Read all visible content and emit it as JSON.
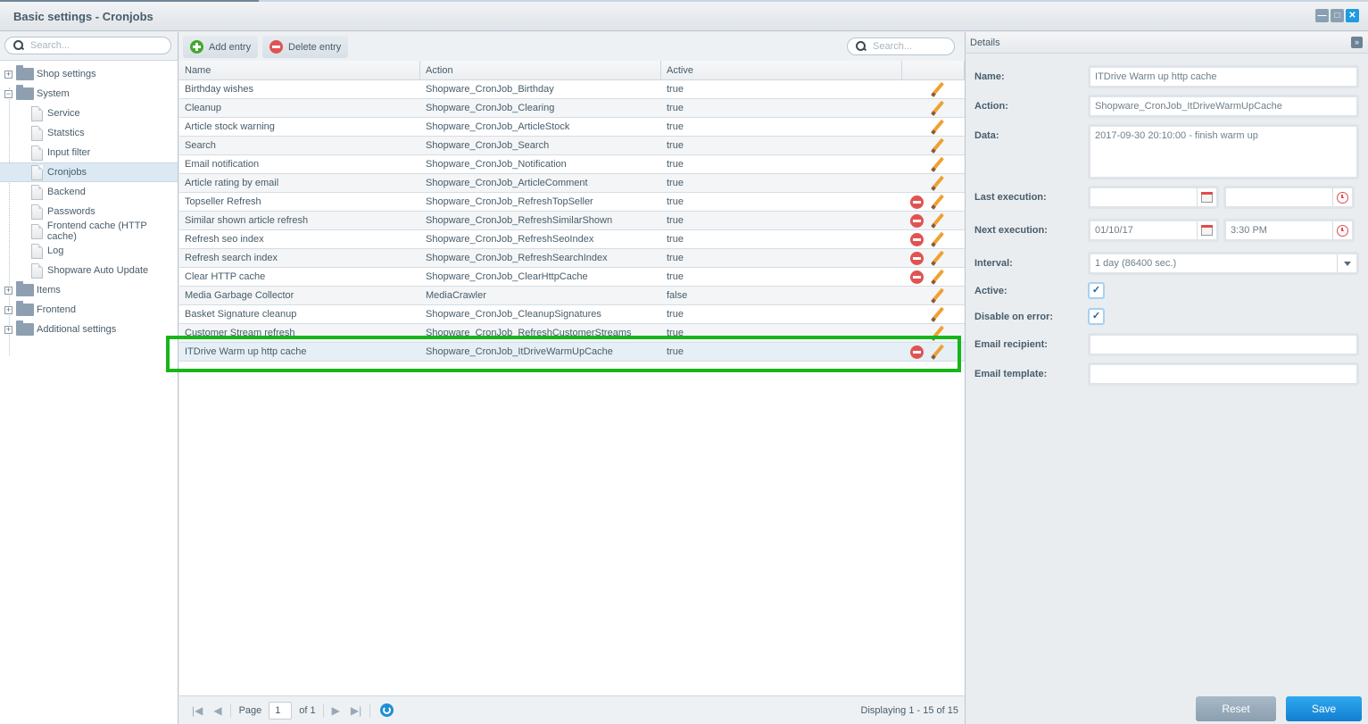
{
  "window": {
    "title": "Basic settings - Cronjobs",
    "buttons": {
      "minimize": "minimize-icon",
      "maximize": "maximize-icon",
      "close": "close-icon"
    }
  },
  "tree": {
    "search_placeholder": "Search...",
    "nodes": [
      {
        "label": "Shop settings",
        "type": "folder",
        "expanded": false
      },
      {
        "label": "System",
        "type": "folder",
        "expanded": true
      },
      {
        "label": "Service",
        "type": "leaf"
      },
      {
        "label": "Statstics",
        "type": "leaf"
      },
      {
        "label": "Input filter",
        "type": "leaf"
      },
      {
        "label": "Cronjobs",
        "type": "leaf",
        "selected": true
      },
      {
        "label": "Backend",
        "type": "leaf"
      },
      {
        "label": "Passwords",
        "type": "leaf"
      },
      {
        "label": "Frontend cache (HTTP cache)",
        "type": "leaf"
      },
      {
        "label": "Log",
        "type": "leaf"
      },
      {
        "label": "Shopware Auto Update",
        "type": "leaf"
      },
      {
        "label": "Items",
        "type": "folder",
        "expanded": false
      },
      {
        "label": "Frontend",
        "type": "folder",
        "expanded": false
      },
      {
        "label": "Additional settings",
        "type": "folder",
        "expanded": false
      }
    ]
  },
  "grid": {
    "toolbar": {
      "add_label": "Add entry",
      "delete_label": "Delete entry",
      "search_placeholder": "Search..."
    },
    "columns": [
      "Name",
      "Action",
      "Active",
      ""
    ],
    "rows": [
      {
        "name": "Birthday wishes",
        "action": "Shopware_CronJob_Birthday",
        "active": "true",
        "deletable": false
      },
      {
        "name": "Cleanup",
        "action": "Shopware_CronJob_Clearing",
        "active": "true",
        "deletable": false
      },
      {
        "name": "Article stock warning",
        "action": "Shopware_CronJob_ArticleStock",
        "active": "true",
        "deletable": false
      },
      {
        "name": "Search",
        "action": "Shopware_CronJob_Search",
        "active": "true",
        "deletable": false
      },
      {
        "name": "Email notification",
        "action": "Shopware_CronJob_Notification",
        "active": "true",
        "deletable": false
      },
      {
        "name": "Article rating by email",
        "action": "Shopware_CronJob_ArticleComment",
        "active": "true",
        "deletable": false
      },
      {
        "name": "Topseller Refresh",
        "action": "Shopware_CronJob_RefreshTopSeller",
        "active": "true",
        "deletable": true
      },
      {
        "name": "Similar shown article refresh",
        "action": "Shopware_CronJob_RefreshSimilarShown",
        "active": "true",
        "deletable": true
      },
      {
        "name": "Refresh seo index",
        "action": "Shopware_CronJob_RefreshSeoIndex",
        "active": "true",
        "deletable": true
      },
      {
        "name": "Refresh search index",
        "action": "Shopware_CronJob_RefreshSearchIndex",
        "active": "true",
        "deletable": true
      },
      {
        "name": "Clear HTTP cache",
        "action": "Shopware_CronJob_ClearHttpCache",
        "active": "true",
        "deletable": true
      },
      {
        "name": "Media Garbage Collector",
        "action": "MediaCrawler",
        "active": "false",
        "deletable": false
      },
      {
        "name": "Basket Signature cleanup",
        "action": "Shopware_CronJob_CleanupSignatures",
        "active": "true",
        "deletable": false
      },
      {
        "name": "Customer Stream refresh",
        "action": "Shopware_CronJob_RefreshCustomerStreams",
        "active": "true",
        "deletable": false
      },
      {
        "name": "ITDrive Warm up http cache",
        "action": "Shopware_CronJob_ItDriveWarmUpCache",
        "active": "true",
        "deletable": true,
        "selected": true
      }
    ],
    "pager": {
      "page_label": "Page",
      "page_value": "1",
      "of_label": "of 1",
      "display_text": "Displaying 1 - 15 of 15"
    }
  },
  "details": {
    "title": "Details",
    "fields": {
      "name": {
        "label": "Name:",
        "value": "ITDrive Warm up http cache"
      },
      "action": {
        "label": "Action:",
        "value": "Shopware_CronJob_ItDriveWarmUpCache"
      },
      "data": {
        "label": "Data:",
        "value": "2017-09-30 20:10:00 - finish warm up"
      },
      "last_execution": {
        "label": "Last execution:",
        "date": "",
        "time": ""
      },
      "next_execution": {
        "label": "Next execution:",
        "date": "01/10/17",
        "time": "3:30 PM"
      },
      "interval": {
        "label": "Interval:",
        "value": "1 day (86400 sec.)"
      },
      "active": {
        "label": "Active:",
        "checked": true
      },
      "disable_on_error": {
        "label": "Disable on error:",
        "checked": true
      },
      "email_recipient": {
        "label": "Email recipient:",
        "value": ""
      },
      "email_template": {
        "label": "Email template:",
        "value": ""
      }
    },
    "buttons": {
      "reset": "Reset",
      "save": "Save"
    }
  },
  "colors": {
    "accent": "#1f9be0",
    "highlight": "#18b51a",
    "selected_row": "#e6eff6",
    "delete_red": "#e05353",
    "add_green": "#44a82c"
  }
}
